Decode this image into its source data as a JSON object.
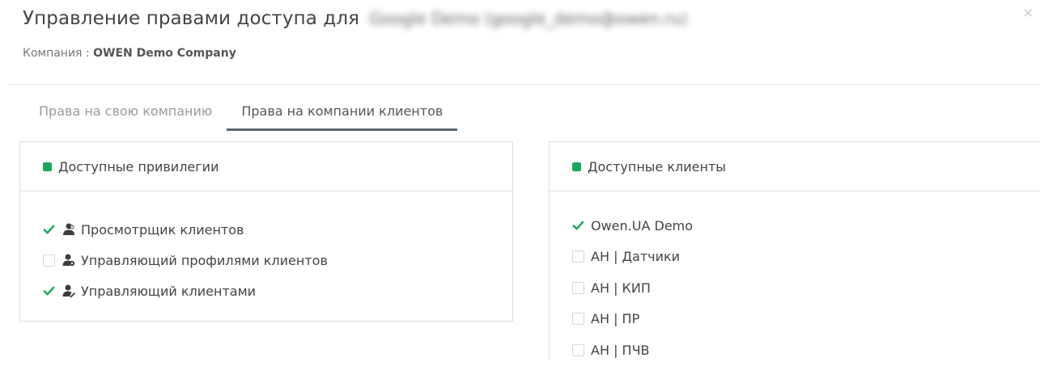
{
  "dialog": {
    "title": "Управление правами доступа для",
    "user_redacted": "Google Demo (google_demo@owen.ru)",
    "close": "×",
    "company_label": "Компания :",
    "company_name": "OWEN Demo Company"
  },
  "tabs": [
    {
      "label": "Права на свою компанию",
      "active": false
    },
    {
      "label": "Права на компании клиентов",
      "active": true
    }
  ],
  "privileges": {
    "title": "Доступные привилегии",
    "items": [
      {
        "label": "Просмотрщик клиентов",
        "checked": true,
        "icon": "users-view-icon"
      },
      {
        "label": "Управляющий профилями клиентов",
        "checked": false,
        "icon": "user-settings-icon"
      },
      {
        "label": "Управляющий клиентами",
        "checked": true,
        "icon": "user-edit-icon"
      }
    ]
  },
  "clients": {
    "title": "Доступные клиенты",
    "items": [
      {
        "label": "Owen.UA Demo",
        "checked": true
      },
      {
        "label": "АН | Датчики",
        "checked": false
      },
      {
        "label": "АН | КИП",
        "checked": false
      },
      {
        "label": "АН | ПР",
        "checked": false
      },
      {
        "label": "АН | ПЧВ",
        "checked": false
      }
    ]
  },
  "colors": {
    "accent": "#1aa55c",
    "check": "#1aa55c",
    "tab_underline": "#5a6773"
  }
}
